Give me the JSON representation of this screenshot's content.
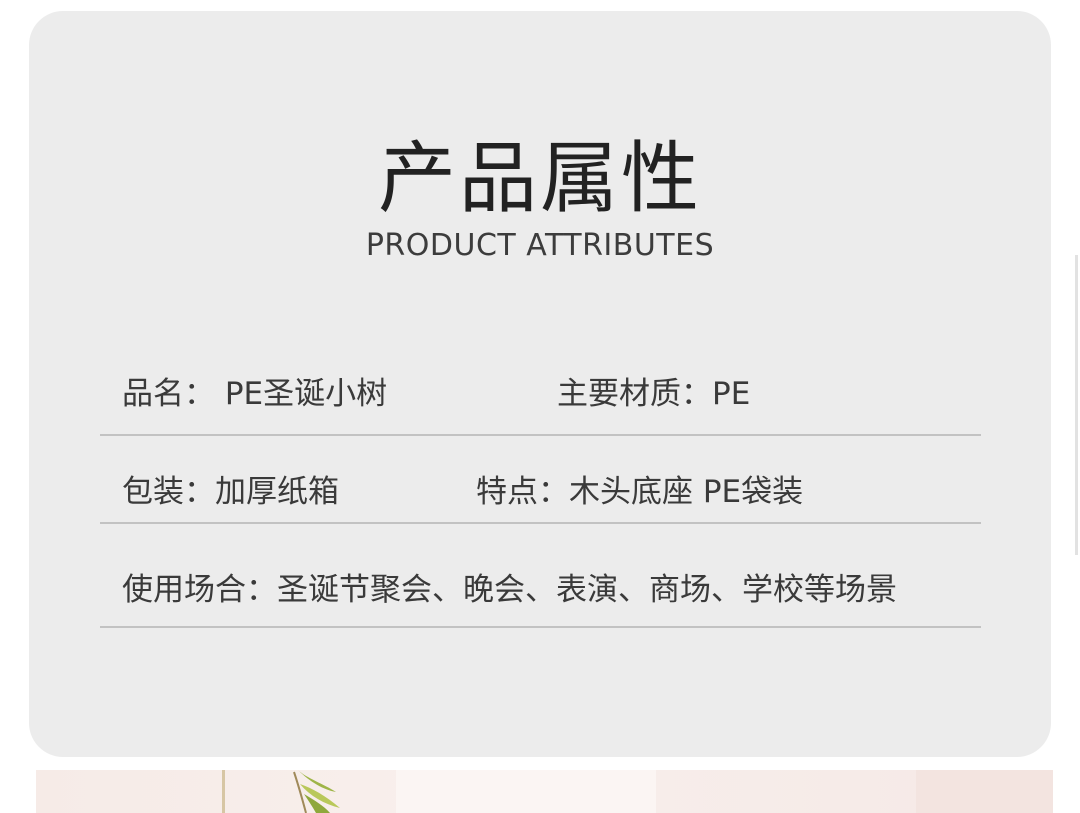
{
  "header": {
    "title_zh": "产品属性",
    "title_en": "PRODUCT ATTRIBUTES"
  },
  "attributes": {
    "row1": {
      "left": "品名：  PE圣诞小树",
      "right": "主要材质：PE"
    },
    "row2": {
      "left": "包装：加厚纸箱",
      "right": "特点：木头底座 PE袋装"
    },
    "row3": {
      "full": "使用场合：圣诞节聚会、晚会、表演、商场、学校等场景"
    }
  },
  "colors": {
    "card_background": "#ececec",
    "text": "#3a3a3a",
    "divider": "#c2c2c2"
  },
  "icons": {
    "bottom_strip": "leaf-icon"
  }
}
